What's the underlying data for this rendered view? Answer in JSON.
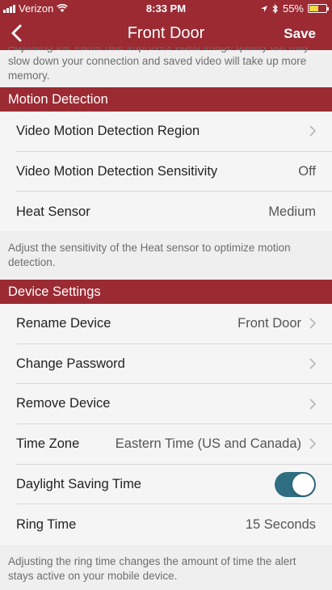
{
  "status_bar": {
    "carrier": "Verizon",
    "time": "8:33 PM",
    "battery": "55%",
    "battery_level": 0.55
  },
  "nav": {
    "title": "Front Door",
    "save_label": "Save"
  },
  "top_note": "Adjusting the frame rate improves video image quality but may slow down your connection and saved video will take up more memory.",
  "motion_section": {
    "header": "Motion Detection",
    "rows": [
      {
        "label": "Video Motion Detection Region",
        "value": ""
      },
      {
        "label": "Video Motion Detection Sensitivity",
        "value": "Off"
      },
      {
        "label": "Heat Sensor",
        "value": "Medium"
      }
    ],
    "note": "Adjust the sensitivity of the Heat sensor to optimize motion detection."
  },
  "device_section": {
    "header": "Device Settings",
    "rows": [
      {
        "label": "Rename Device",
        "value": "Front Door"
      },
      {
        "label": "Change Password",
        "value": ""
      },
      {
        "label": "Remove Device",
        "value": ""
      },
      {
        "label": "Time Zone",
        "value": "Eastern Time (US and Canada)"
      },
      {
        "label": "Daylight Saving Time",
        "value": ""
      },
      {
        "label": "Ring Time",
        "value": "15 Seconds"
      }
    ],
    "daylight_saving_on": true,
    "note": "Adjusting the ring time changes the amount of time the alert stays active on your mobile device."
  },
  "colors": {
    "brand": "#9b2a33",
    "toggle_on": "#2f6e82",
    "background": "#efeff0"
  }
}
